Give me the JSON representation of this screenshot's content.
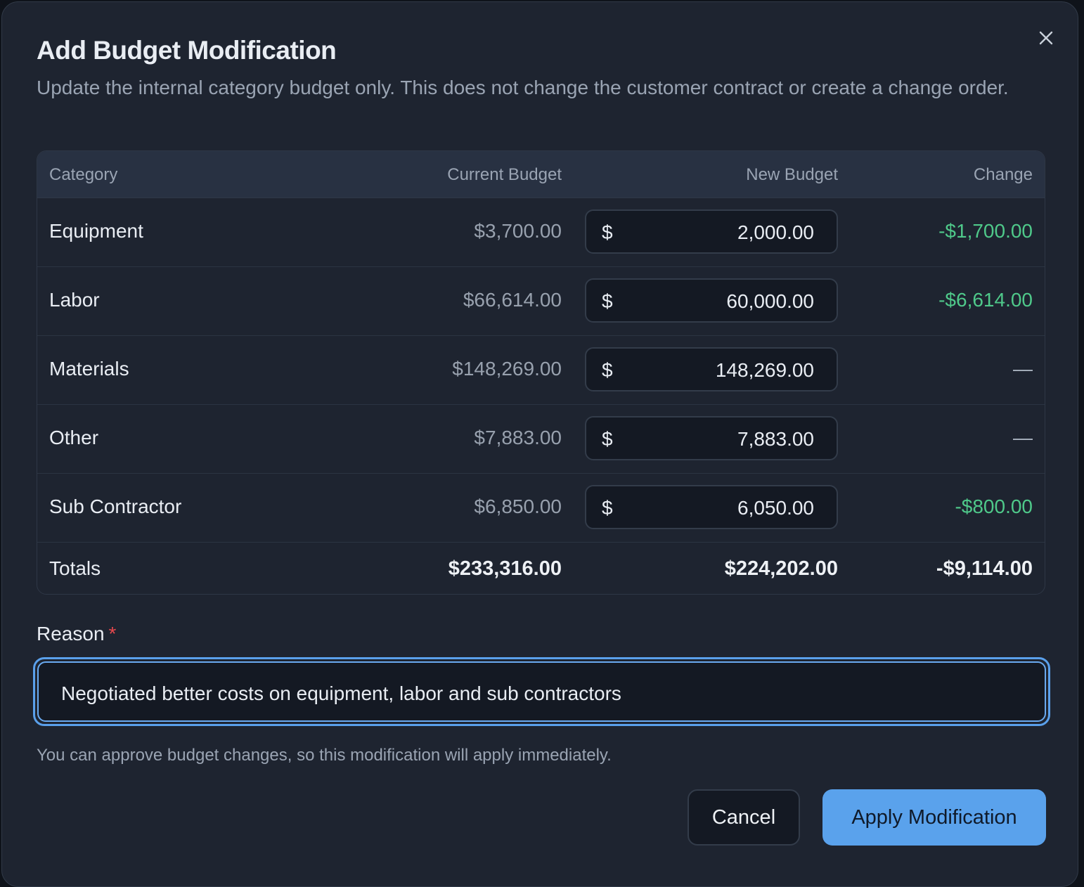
{
  "dialog": {
    "title": "Add Budget Modification",
    "subtitle": "Update the internal category budget only. This does not change the customer contract or create a change order.",
    "close_icon": "close-icon"
  },
  "table": {
    "headers": {
      "category": "Category",
      "current": "Current Budget",
      "new": "New Budget",
      "change": "Change"
    },
    "currency_symbol": "$",
    "rows": [
      {
        "category": "Equipment",
        "current": "$3,700.00",
        "new_value": "2,000.00",
        "change": "-$1,700.00"
      },
      {
        "category": "Labor",
        "current": "$66,614.00",
        "new_value": "60,000.00",
        "change": "-$6,614.00"
      },
      {
        "category": "Materials",
        "current": "$148,269.00",
        "new_value": "148,269.00",
        "change": "—"
      },
      {
        "category": "Other",
        "current": "$7,883.00",
        "new_value": "7,883.00",
        "change": "—"
      },
      {
        "category": "Sub Contractor",
        "current": "$6,850.00",
        "new_value": "6,050.00",
        "change": "-$800.00"
      }
    ],
    "totals": {
      "label": "Totals",
      "current": "$233,316.00",
      "new": "$224,202.00",
      "change": "-$9,114.00"
    }
  },
  "reason": {
    "label": "Reason",
    "required_mark": "*",
    "value": "Negotiated better costs on equipment, labor and sub contractors"
  },
  "hint": "You can approve budget changes, so this modification will apply immediately.",
  "buttons": {
    "cancel": "Cancel",
    "apply": "Apply Modification"
  },
  "colors": {
    "negative_change": "#4fc98a",
    "accent": "#5aa2ec",
    "required": "#e5484d"
  }
}
